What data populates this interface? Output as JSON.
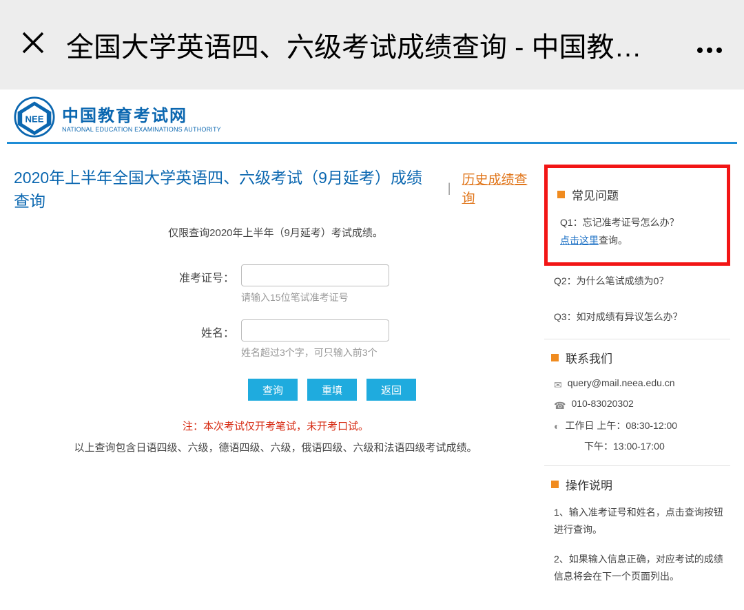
{
  "top": {
    "title": "全国大学英语四、六级考试成绩查询 - 中国教…"
  },
  "logo": {
    "cn": "中国教育考试网",
    "en": "NATIONAL EDUCATION EXAMINATIONS AUTHORITY"
  },
  "main": {
    "title": "2020年上半年全国大学英语四、六级考试（9月延考）成绩查询",
    "sep": "|",
    "history_link": "历史成绩查询",
    "sub_note": "仅限查询2020年上半年（9月延考）考试成绩。",
    "label_ticket": "准考证号：",
    "hint_ticket": "请输入15位笔试准考证号",
    "label_name": "姓名：",
    "hint_name": "姓名超过3个字，可只输入前3个",
    "btn_query": "查询",
    "btn_reset": "重填",
    "btn_back": "返回",
    "warning": "注：本次考试仅开考笔试，未开考口试。",
    "info_note": "以上查询包含日语四级、六级，德语四级、六级，俄语四级、六级和法语四级考试成绩。"
  },
  "side": {
    "faq_title": "常见问题",
    "q1_text": "Q1：忘记准考证号怎么办？",
    "q1_link": "点击这里",
    "q1_tail": "查询。",
    "q2": "Q2：为什么笔试成绩为0？",
    "q3": "Q3：如对成绩有异议怎么办？",
    "contact_title": "联系我们",
    "email": "query@mail.neea.edu.cn",
    "phone": "010-83020302",
    "hours1": "工作日 上午：08:30-12:00",
    "hours2": "下午：13:00-17:00",
    "ops_title": "操作说明",
    "ops1": "1、输入准考证号和姓名，点击查询按钮进行查询。",
    "ops2": "2、如果输入信息正确，对应考试的成绩信息将会在下一个页面列出。"
  }
}
